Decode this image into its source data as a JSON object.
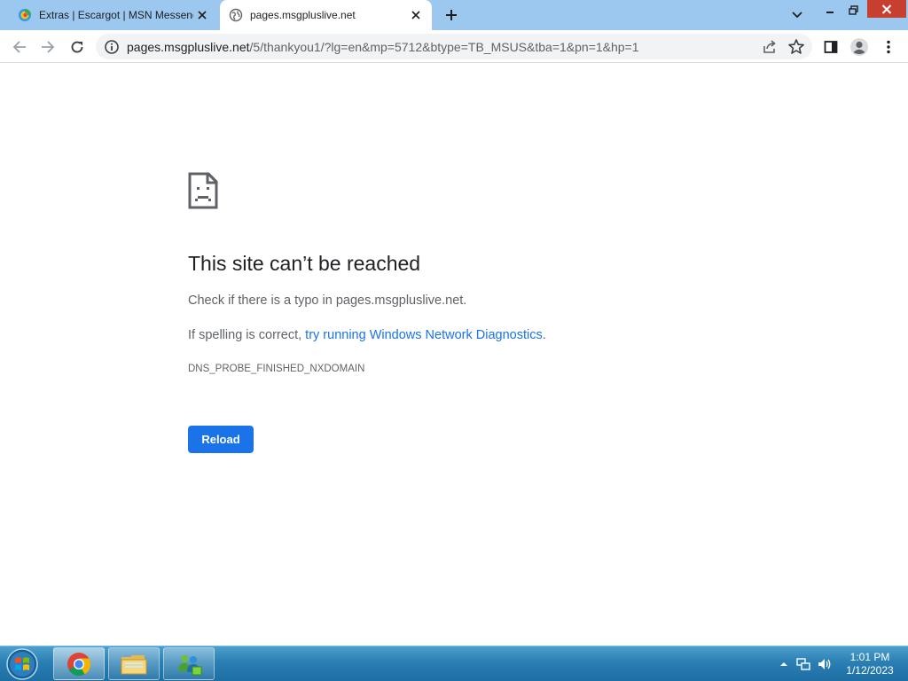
{
  "browser": {
    "tabs": [
      {
        "title": "Extras | Escargot | MSN Messenger",
        "active": false,
        "icon": "escargot-favicon"
      },
      {
        "title": "pages.msgpluslive.net",
        "active": true,
        "icon": "globe-icon"
      }
    ],
    "address_bar": {
      "host": "pages.msgpluslive.net",
      "path": "/5/thankyou1/?lg=en&mp=5712&btype=TB_MSUS&tba=1&pn=1&hp=1"
    }
  },
  "error_page": {
    "title": "This site can’t be reached",
    "line1": "Check if there is a typo in pages.msgpluslive.net.",
    "line2_prefix": "If spelling is correct, ",
    "line2_link": "try running Windows Network Diagnostics",
    "line2_suffix": ".",
    "error_code": "DNS_PROBE_FINISHED_NXDOMAIN",
    "reload_label": "Reload"
  },
  "taskbar": {
    "apps": [
      "chrome-icon",
      "file-explorer-icon",
      "messenger-icon"
    ],
    "clock": {
      "time": "1:01 PM",
      "date": "1/12/2023"
    }
  },
  "colors": {
    "tabstrip": "#9cc7ef",
    "link": "#1a73e8",
    "reload_button": "#1a73e8",
    "close_button": "#c7402f"
  }
}
